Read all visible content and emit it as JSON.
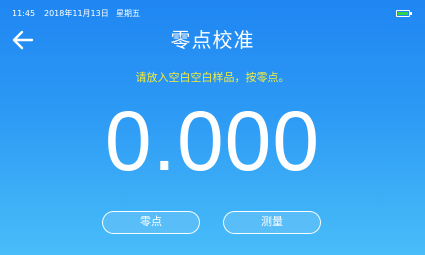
{
  "status_bar": {
    "time": "11:45",
    "date": "2018年11月13日",
    "weekday": "星期五",
    "battery_level": 1.0,
    "battery_color": "#2fd34a"
  },
  "header": {
    "back_icon": "arrow-left-icon",
    "title": "零点校准"
  },
  "main": {
    "hint": "请放入空白空白样品，按零点。",
    "hint_color": "#f4ec3b",
    "reading": "0.000"
  },
  "buttons": {
    "zero_label": "零点",
    "measure_label": "测量"
  }
}
